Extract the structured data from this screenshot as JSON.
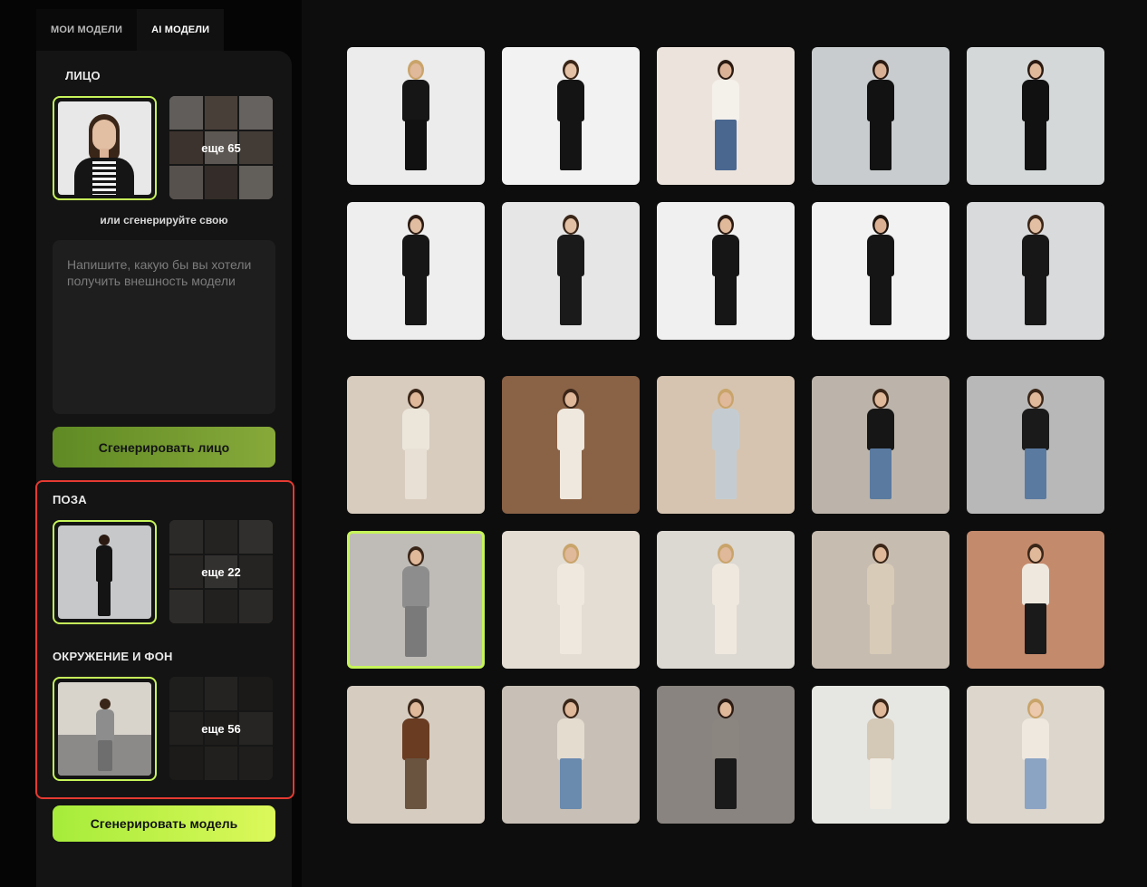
{
  "tabs": [
    {
      "label": "МОИ МОДЕЛИ",
      "active": false
    },
    {
      "label": "AI МОДЕЛИ",
      "active": true
    }
  ],
  "face": {
    "title": "ЛИЦО",
    "more_label": "еще 65",
    "or_text": "или сгенерируйте свою",
    "prompt_placeholder": "Напишите, какую бы вы хотели получить внешность модели",
    "button": "Сгенерировать лицо"
  },
  "pose": {
    "title": "ПОЗА",
    "more_label": "еще 22"
  },
  "environment": {
    "title": "ОКРУЖЕНИЕ И ФОН",
    "more_label": "еще 56"
  },
  "generate_model_button": "Сгенерировать модель",
  "colors": {
    "accent": "#c6f45a",
    "highlight": "#e53a31"
  },
  "gallery": {
    "group_1": [
      {
        "name": "model-black-blazer",
        "bg": "#ececec",
        "top": "#161616",
        "bottom": "#111111",
        "skin": "#e0b89a",
        "hair": "#c9a46a"
      },
      {
        "name": "model-black-tshirt",
        "bg": "#f2f2f2",
        "top": "#141414",
        "bottom": "#141414",
        "skin": "#e4c0a4",
        "hair": "#3a2618"
      },
      {
        "name": "model-sitting-chair",
        "bg": "#ece4dc",
        "top": "#f4f0ea",
        "bottom": "#4a6790",
        "skin": "#dcb296",
        "hair": "#2a1a12"
      },
      {
        "name": "model-black-jumpsuit",
        "bg": "#c8ccce",
        "top": "#121212",
        "bottom": "#121212",
        "skin": "#dab094",
        "hair": "#2a1a12"
      },
      {
        "name": "model-black-gown",
        "bg": "#d4d8d8",
        "top": "#111111",
        "bottom": "#111111",
        "skin": "#e0b89a",
        "hair": "#2a1a12"
      },
      {
        "name": "model-black-dress",
        "bg": "#eeeeee",
        "top": "#161616",
        "bottom": "#161616",
        "skin": "#e0bca0",
        "hair": "#2a1a12"
      },
      {
        "name": "model-black-wrap-dress",
        "bg": "#e6e6e6",
        "top": "#1a1a1a",
        "bottom": "#1a1a1a",
        "skin": "#e2c0a4",
        "hair": "#3a2618"
      },
      {
        "name": "model-black-knit-dress",
        "bg": "#f0f0f0",
        "top": "#161616",
        "bottom": "#161616",
        "skin": "#e0b89a",
        "hair": "#2a1a12"
      },
      {
        "name": "model-black-crop-top",
        "bg": "#f2f2f2",
        "top": "#151515",
        "bottom": "#151515",
        "skin": "#dcb092",
        "hair": "#1e140e"
      },
      {
        "name": "model-black-coat-pose",
        "bg": "#d8dadc",
        "top": "#171717",
        "bottom": "#171717",
        "skin": "#e2bea2",
        "hair": "#3a2618"
      }
    ],
    "group_2": [
      {
        "name": "scene-white-corridor",
        "bg": "#d8ccbe",
        "top": "#ece6da",
        "bottom": "#e8e0d4",
        "skin": "#e0b89a",
        "hair": "#3a2618"
      },
      {
        "name": "scene-forest-path",
        "bg": "#8a6246",
        "top": "#efe8de",
        "bottom": "#efe8de",
        "skin": "#e0b89a",
        "hair": "#3a2618"
      },
      {
        "name": "scene-marble-hall",
        "bg": "#d6c4b0",
        "top": "#c4ccd2",
        "bottom": "#c4ccd2",
        "skin": "#e0b89a",
        "hair": "#c9a46a"
      },
      {
        "name": "scene-old-street-jeans",
        "bg": "#bcb4aa",
        "top": "#161616",
        "bottom": "#5a7aa0",
        "skin": "#e0b89a",
        "hair": "#3a2618"
      },
      {
        "name": "scene-studio-coat",
        "bg": "#b8b8b8",
        "top": "#1a1a1a",
        "bottom": "#5a7aa0",
        "skin": "#e0b89a",
        "hair": "#3a2618"
      },
      {
        "name": "scene-city-street-plaid",
        "bg": "#bfbcb8",
        "top": "#8d8d8d",
        "bottom": "#7a7a7a",
        "skin": "#e0b89a",
        "hair": "#3a2618",
        "selected": true
      },
      {
        "name": "scene-white-wall-sweater",
        "bg": "#e4ddd4",
        "top": "#efe8de",
        "bottom": "#efe8de",
        "skin": "#e0b89a",
        "hair": "#c9a46a"
      },
      {
        "name": "scene-white-building",
        "bg": "#dcd8d2",
        "top": "#efe8de",
        "bottom": "#efe8de",
        "skin": "#e0b89a",
        "hair": "#c9a46a"
      },
      {
        "name": "scene-beige-trench",
        "bg": "#c7bcb0",
        "top": "#d8ccb8",
        "bottom": "#d8ccb8",
        "skin": "#e0b89a",
        "hair": "#3a2618"
      },
      {
        "name": "scene-terracotta-wall",
        "bg": "#c48a6c",
        "top": "#efe8de",
        "bottom": "#1a1a1a",
        "skin": "#e0b89a",
        "hair": "#3a2618"
      },
      {
        "name": "scene-plaid-skirt",
        "bg": "#d6ccc0",
        "top": "#6a3c22",
        "bottom": "#6a5440",
        "skin": "#e0b89a",
        "hair": "#3a2618"
      },
      {
        "name": "scene-old-town-jeans",
        "bg": "#c8c0b6",
        "top": "#e4dccf",
        "bottom": "#6a8aae",
        "skin": "#e0b89a",
        "hair": "#3a2618"
      },
      {
        "name": "scene-gate-poncho",
        "bg": "#8a8480",
        "top": "#8c8680",
        "bottom": "#1a1a1a",
        "skin": "#e0b89a",
        "hair": "#2a1a12"
      },
      {
        "name": "scene-bright-room-coat",
        "bg": "#e6e6e2",
        "top": "#d4c8b6",
        "bottom": "#efeae2",
        "skin": "#e0b89a",
        "hair": "#3a2618"
      },
      {
        "name": "scene-kid-blue-dress",
        "bg": "#dcd6cc",
        "top": "#efe8de",
        "bottom": "#8ca4c4",
        "skin": "#ecc8ac",
        "hair": "#c9a46a"
      }
    ]
  }
}
